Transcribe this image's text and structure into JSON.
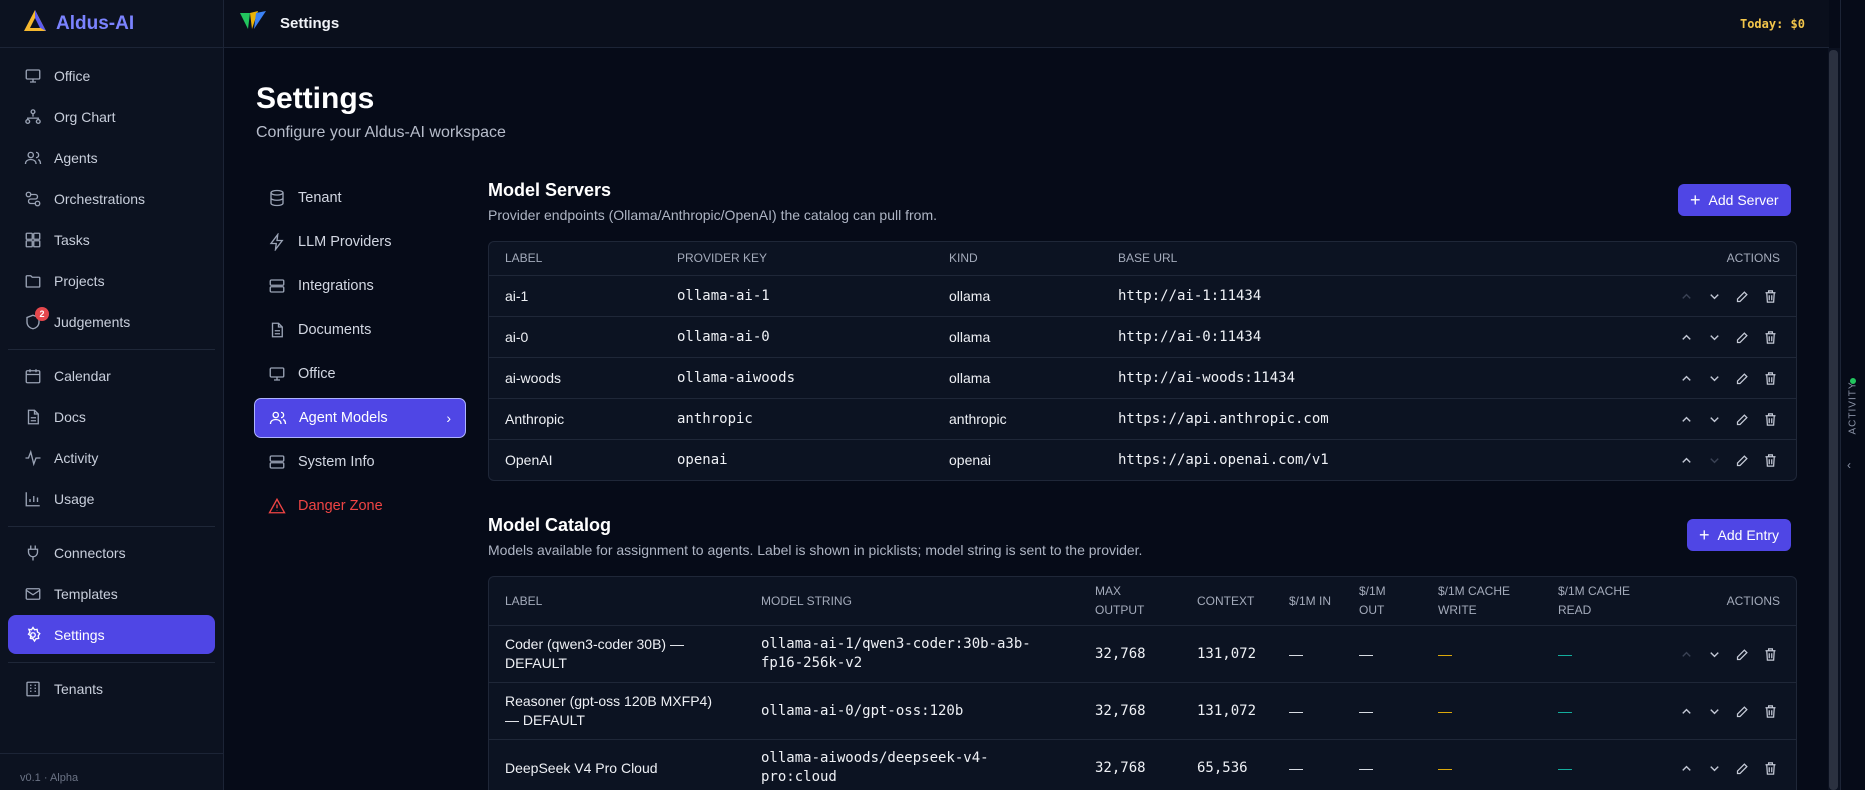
{
  "app": {
    "name": "Aldus-AI",
    "version": "v0.1 · Alpha"
  },
  "topbar": {
    "title": "Settings",
    "today": "Today: $0"
  },
  "colors": {
    "accent": "#4f46e5",
    "brand": "#7b83ff",
    "danger": "#ef4444",
    "today": "#f3c64b"
  },
  "sidebar": {
    "groups": [
      [
        {
          "label": "Office",
          "icon": "monitor-icon"
        },
        {
          "label": "Org Chart",
          "icon": "org-chart-icon"
        },
        {
          "label": "Agents",
          "icon": "users-icon"
        },
        {
          "label": "Orchestrations",
          "icon": "workflow-icon"
        },
        {
          "label": "Tasks",
          "icon": "grid-icon"
        },
        {
          "label": "Projects",
          "icon": "folder-icon"
        },
        {
          "label": "Judgements",
          "icon": "shield-icon",
          "badge": "2"
        }
      ],
      [
        {
          "label": "Calendar",
          "icon": "calendar-icon"
        },
        {
          "label": "Docs",
          "icon": "document-icon"
        },
        {
          "label": "Activity",
          "icon": "pulse-icon"
        },
        {
          "label": "Usage",
          "icon": "bar-chart-icon"
        }
      ],
      [
        {
          "label": "Connectors",
          "icon": "plug-icon"
        },
        {
          "label": "Templates",
          "icon": "mail-icon"
        },
        {
          "label": "Settings",
          "icon": "gear-icon",
          "active": true
        }
      ],
      [
        {
          "label": "Tenants",
          "icon": "building-icon"
        }
      ]
    ]
  },
  "page": {
    "title": "Settings",
    "subtitle": "Configure your Aldus-AI workspace"
  },
  "settings_nav": [
    {
      "label": "Tenant",
      "icon": "database-icon"
    },
    {
      "label": "LLM Providers",
      "icon": "bolt-icon"
    },
    {
      "label": "Integrations",
      "icon": "server-icon"
    },
    {
      "label": "Documents",
      "icon": "document-icon"
    },
    {
      "label": "Office",
      "icon": "monitor-icon"
    },
    {
      "label": "Agent Models",
      "icon": "users-icon",
      "active": true
    },
    {
      "label": "System Info",
      "icon": "server-icon"
    },
    {
      "label": "Danger Zone",
      "icon": "warning-icon",
      "danger": true
    }
  ],
  "model_servers": {
    "title": "Model Servers",
    "description": "Provider endpoints (Ollama/Anthropic/OpenAI) the catalog can pull from.",
    "add_label": "Add Server",
    "columns": [
      "LABEL",
      "PROVIDER KEY",
      "KIND",
      "BASE URL",
      "ACTIONS"
    ],
    "rows": [
      {
        "label": "ai-1",
        "provider_key": "ollama-ai-1",
        "kind": "ollama",
        "base_url": "http://ai-1:11434"
      },
      {
        "label": "ai-0",
        "provider_key": "ollama-ai-0",
        "kind": "ollama",
        "base_url": "http://ai-0:11434"
      },
      {
        "label": "ai-woods",
        "provider_key": "ollama-aiwoods",
        "kind": "ollama",
        "base_url": "http://ai-woods:11434"
      },
      {
        "label": "Anthropic",
        "provider_key": "anthropic",
        "kind": "anthropic",
        "base_url": "https://api.anthropic.com"
      },
      {
        "label": "OpenAI",
        "provider_key": "openai",
        "kind": "openai",
        "base_url": "https://api.openai.com/v1"
      }
    ]
  },
  "model_catalog": {
    "title": "Model Catalog",
    "description": "Models available for assignment to agents. Label is shown in picklists; model string is sent to the provider.",
    "add_label": "Add Entry",
    "columns": [
      "LABEL",
      "MODEL STRING",
      "MAX OUTPUT",
      "CONTEXT",
      "$/1M IN",
      "$/1M OUT",
      "$/1M CACHE WRITE",
      "$/1M CACHE READ",
      "ACTIONS"
    ],
    "rows": [
      {
        "label": "Coder (qwen3-coder 30B) — DEFAULT",
        "model_string": "ollama-ai-1/qwen3-coder:30b-a3b-fp16-256k-v2",
        "max_output": "32,768",
        "context": "131,072",
        "in": "—",
        "out": "—",
        "cache_write": "—",
        "cache_read": "—"
      },
      {
        "label": "Reasoner (gpt-oss 120B MXFP4) — DEFAULT",
        "model_string": "ollama-ai-0/gpt-oss:120b",
        "max_output": "32,768",
        "context": "131,072",
        "in": "—",
        "out": "—",
        "cache_write": "—",
        "cache_read": "—"
      },
      {
        "label": "DeepSeek V4 Pro Cloud",
        "model_string": "ollama-aiwoods/deepseek-v4-pro:cloud",
        "max_output": "32,768",
        "context": "65,536",
        "in": "—",
        "out": "—",
        "cache_write": "—",
        "cache_read": "—"
      }
    ]
  },
  "activity_rail": {
    "label": "ACTIVITY"
  }
}
